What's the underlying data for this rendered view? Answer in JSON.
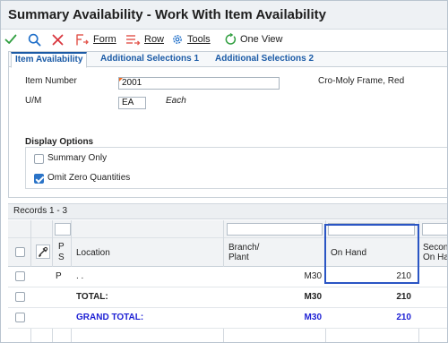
{
  "window": {
    "title": "Summary Availability - Work With Item Availability"
  },
  "toolbar": {
    "form_label": "Form",
    "row_label": "Row",
    "tools_label": "Tools",
    "one_view_label": "One View"
  },
  "tabs": [
    {
      "label": "Item Availability",
      "active": true
    },
    {
      "label": "Additional Selections 1",
      "active": false
    },
    {
      "label": "Additional Selections 2",
      "active": false
    }
  ],
  "header_fields": {
    "item_number_label": "Item Number",
    "item_number_value": "2001",
    "item_description": "Cro-Moly Frame, Red",
    "um_label": "U/M",
    "um_value": "EA",
    "um_description": "Each"
  },
  "display_options": {
    "title": "Display Options",
    "summary_only": {
      "label": "Summary Only",
      "checked": false
    },
    "omit_zero": {
      "label": "Omit Zero Quantities",
      "checked": true
    }
  },
  "grid": {
    "records_label": "Records 1 - 3",
    "columns": {
      "ps_line1": "P",
      "ps_line2": "S",
      "location": "Location",
      "branch_line1": "Branch/",
      "branch_line2": "Plant",
      "on_hand": "On Hand",
      "secondary_line1": "Secon",
      "secondary_line2": "On Ha"
    },
    "rows": [
      {
        "ps": "P",
        "location": ". .",
        "branch": "M30",
        "on_hand": "210",
        "style": "normal"
      },
      {
        "ps": "",
        "location": "TOTAL:",
        "branch": "M30",
        "on_hand": "210",
        "style": "total"
      },
      {
        "ps": "",
        "location": "GRAND TOTAL:",
        "branch": "M30",
        "on_hand": "210",
        "style": "grand"
      }
    ]
  },
  "colors": {
    "accent": "#1a5aa6",
    "grand_total_text": "#1c1fd4",
    "highlight_box": "#2a55c4",
    "required_marker": "#f26b21",
    "checkbox_checked": "#2a73c7"
  },
  "icons": [
    "check-icon",
    "search-icon",
    "close-icon",
    "form-icon",
    "row-icon",
    "tools-gear-icon",
    "one-view-icon",
    "row-exit-icon"
  ]
}
